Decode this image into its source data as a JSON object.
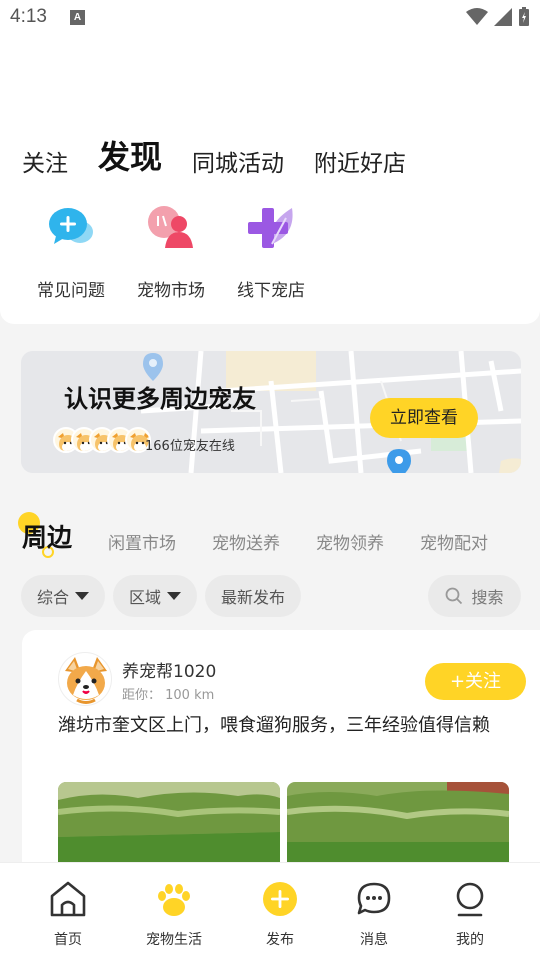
{
  "status": {
    "time": "4:13",
    "notif_letter": "A"
  },
  "tabs": [
    {
      "label": "关注"
    },
    {
      "label": "发现"
    },
    {
      "label": "同城活动"
    },
    {
      "label": "附近好店"
    }
  ],
  "quick": [
    {
      "label": "常见问题",
      "icon": "chat-plus-icon"
    },
    {
      "label": "宠物市场",
      "icon": "people-icon"
    },
    {
      "label": "线下宠店",
      "icon": "leaf-plus-icon"
    }
  ],
  "banner": {
    "title": "认识更多周边宠友",
    "online": "166位宠友在线",
    "button": "立即查看"
  },
  "subtabs": [
    {
      "label": "周边"
    },
    {
      "label": "闲置市场"
    },
    {
      "label": "宠物送养"
    },
    {
      "label": "宠物领养"
    },
    {
      "label": "宠物配对"
    }
  ],
  "filters": [
    {
      "label": "综合"
    },
    {
      "label": "区域"
    },
    {
      "label": "最新发布"
    }
  ],
  "search": {
    "label": "搜索"
  },
  "post": {
    "name": "养宠帮1020",
    "distance": "距你： 100 km",
    "follow": "+关注",
    "text": "潍坊市奎文区上门，喂食遛狗服务，三年经验值得信赖"
  },
  "tabbar": [
    {
      "label": "首页",
      "icon": "home-icon"
    },
    {
      "label": "宠物生活",
      "icon": "paw-icon"
    },
    {
      "label": "发布",
      "icon": "plus-circle-icon"
    },
    {
      "label": "消息",
      "icon": "message-icon"
    },
    {
      "label": "我的",
      "icon": "user-icon"
    }
  ],
  "colors": {
    "accent": "#ffd426",
    "tab_active": "#111111"
  }
}
